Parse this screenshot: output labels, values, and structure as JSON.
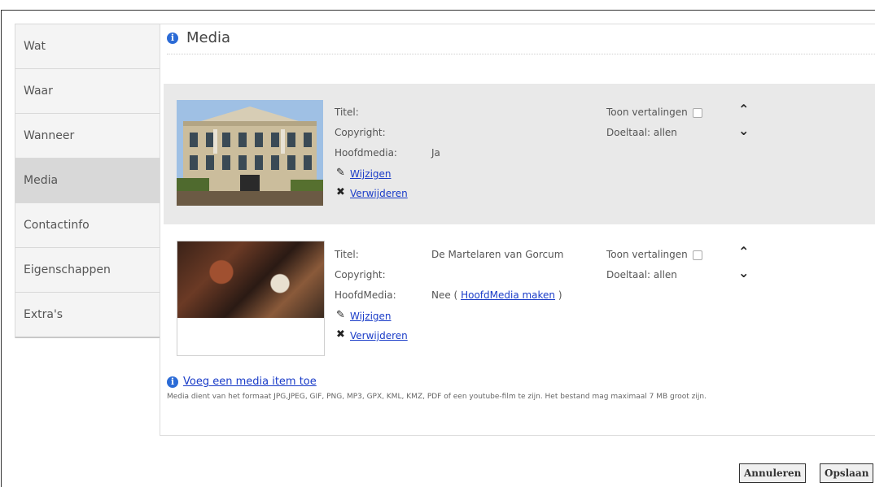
{
  "sidebar": {
    "items": [
      {
        "label": "Wat"
      },
      {
        "label": "Waar"
      },
      {
        "label": "Wanneer"
      },
      {
        "label": "Media"
      },
      {
        "label": "Contactinfo"
      },
      {
        "label": "Eigenschappen"
      },
      {
        "label": "Extra's"
      }
    ],
    "active": "Media"
  },
  "panel": {
    "title": "Media"
  },
  "media_items": [
    {
      "title_label": "Titel:",
      "title_value": "",
      "copyright_label": "Copyright:",
      "hoofd_label": "Hoofdmedia:",
      "hoofd_value": "Ja",
      "hoofd_link": "",
      "edit_label": "Wijzigen",
      "delete_label": "Verwijderen",
      "translations_label": "Toon vertalingen",
      "target_label": "Doeltaal: allen"
    },
    {
      "title_label": "Titel:",
      "title_value": "De Martelaren van Gorcum",
      "copyright_label": "Copyright:",
      "hoofd_label": "HoofdMedia:",
      "hoofd_value": "Nee (",
      "hoofd_link": "HoofdMedia maken",
      "hoofd_suffix": ")",
      "edit_label": "Wijzigen",
      "delete_label": "Verwijderen",
      "translations_label": "Toon vertalingen",
      "target_label": "Doeltaal: allen"
    }
  ],
  "add_item": {
    "label": "Voeg een media item toe",
    "help": "Media dient van het formaat JPG,JPEG, GIF, PNG, MP3, GPX, KML, KMZ, PDF of een youtube-film te zijn. Het bestand mag maximaal 7 MB groot zijn."
  },
  "buttons": {
    "cancel": "Annuleren",
    "save": "Opslaan"
  },
  "colors": {
    "link": "#1a3cc8",
    "info_icon": "#2b6bd6",
    "active_tab": "#d8d8d8"
  }
}
